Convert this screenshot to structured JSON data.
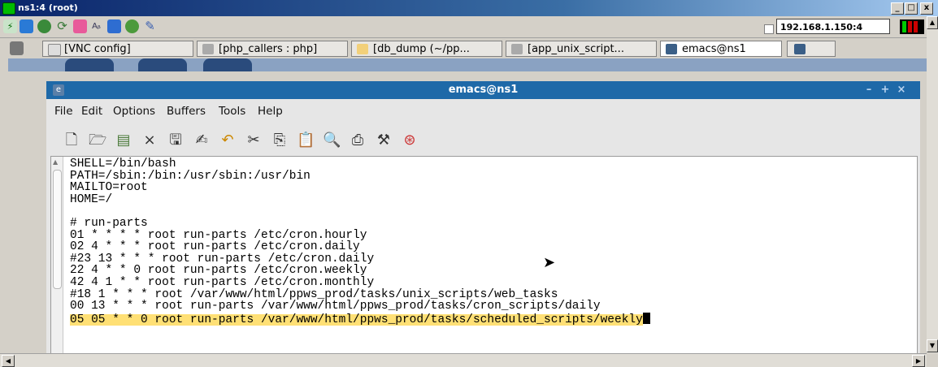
{
  "vnc": {
    "title": "ns1:4 (root)",
    "address": "192.168.1.150:4",
    "min": "_",
    "max": "□",
    "close": "x"
  },
  "taskbar": {
    "tabs": [
      {
        "label": "[VNC config]"
      },
      {
        "label": "[php_callers : php]"
      },
      {
        "label": "[db_dump (~/pp..."
      },
      {
        "label": "[app_unix_script..."
      },
      {
        "label": "emacs@ns1"
      }
    ]
  },
  "emacs": {
    "title": "emacs@ns1",
    "menu": [
      "File",
      "Edit",
      "Options",
      "Buffers",
      "Tools",
      "Help"
    ],
    "lines": [
      "SHELL=/bin/bash",
      "PATH=/sbin:/bin:/usr/sbin:/usr/bin",
      "MAILTO=root",
      "HOME=/",
      "",
      "# run-parts",
      "01 * * * * root run-parts /etc/cron.hourly",
      "02 4 * * * root run-parts /etc/cron.daily",
      "#23 13 * * * root run-parts /etc/cron.daily",
      "22 4 * * 0 root run-parts /etc/cron.weekly",
      "42 4 1 * * root run-parts /etc/cron.monthly",
      "#18 1 * * * root /var/www/html/ppws_prod/tasks/unix_scripts/web_tasks",
      "00 13 * * * root run-parts /var/www/html/ppws_prod/tasks/cron_scripts/daily",
      "05 05 * * 0 root run-parts /var/www/html/ppws_prod/tasks/scheduled_scripts/weekly"
    ]
  },
  "colors": {
    "highlight": "#ffe075",
    "titlebar": "#1e69a8"
  }
}
